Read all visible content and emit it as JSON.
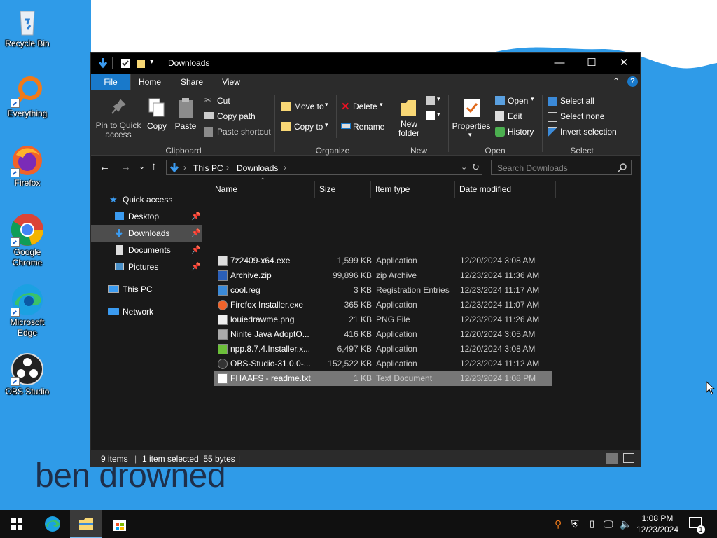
{
  "desktop": {
    "icons": [
      {
        "label": "Recycle Bin",
        "icon": "recycle-bin-icon"
      },
      {
        "label": "Everything",
        "icon": "everything-search-icon"
      },
      {
        "label": "Firefox",
        "icon": "firefox-icon"
      },
      {
        "label": "Google Chrome",
        "icon": "chrome-icon"
      },
      {
        "label": "Microsoft Edge",
        "icon": "edge-icon"
      },
      {
        "label": "OBS Studio",
        "icon": "obs-icon"
      }
    ],
    "wallpaper_text": "ben drowned",
    "colors": {
      "wallpaper_blue": "#2f9be8",
      "wallpaper_white": "#ffffff"
    }
  },
  "window": {
    "title": "Downloads",
    "controls": {
      "minimize": "—",
      "maximize": "☐",
      "close": "✕"
    },
    "tabs": [
      "File",
      "Home",
      "Share",
      "View"
    ],
    "active_tab": "Home",
    "ribbon": {
      "clipboard": {
        "pin": "Pin to Quick access",
        "copy": "Copy",
        "paste": "Paste",
        "cut": "Cut",
        "copy_path": "Copy path",
        "paste_shortcut": "Paste shortcut",
        "group": "Clipboard"
      },
      "organize": {
        "move_to": "Move to",
        "copy_to": "Copy to",
        "delete": "Delete",
        "rename": "Rename",
        "group": "Organize"
      },
      "new": {
        "new_folder": "New folder",
        "group": "New"
      },
      "open": {
        "properties": "Properties",
        "open": "Open",
        "edit": "Edit",
        "history": "History",
        "group": "Open"
      },
      "select": {
        "select_all": "Select all",
        "select_none": "Select none",
        "invert": "Invert selection",
        "group": "Select"
      }
    },
    "address": {
      "crumbs": [
        "This PC",
        "Downloads"
      ],
      "search_placeholder": "Search Downloads"
    },
    "nav": {
      "quick_access": "Quick access",
      "items": [
        "Desktop",
        "Downloads",
        "Documents",
        "Pictures"
      ],
      "this_pc": "This PC",
      "network": "Network",
      "selected": "Downloads"
    },
    "columns": [
      "Name",
      "Size",
      "Item type",
      "Date modified"
    ],
    "files": [
      {
        "name": "7z2409-x64.exe",
        "size": "1,599 KB",
        "type": "Application",
        "date": "12/20/2024 3:08 AM",
        "icon": "7zip-icon"
      },
      {
        "name": "Archive.zip",
        "size": "99,896 KB",
        "type": "zip Archive",
        "date": "12/23/2024 11:36 AM",
        "icon": "zip-icon"
      },
      {
        "name": "cool.reg",
        "size": "3 KB",
        "type": "Registration Entries",
        "date": "12/23/2024 11:17 AM",
        "icon": "registry-icon"
      },
      {
        "name": "Firefox Installer.exe",
        "size": "365 KB",
        "type": "Application",
        "date": "12/23/2024 11:07 AM",
        "icon": "firefox-icon"
      },
      {
        "name": "louiedrawme.png",
        "size": "21 KB",
        "type": "PNG File",
        "date": "12/23/2024 11:26 AM",
        "icon": "image-icon"
      },
      {
        "name": "Ninite Java AdoptO...",
        "size": "416 KB",
        "type": "Application",
        "date": "12/20/2024 3:05 AM",
        "icon": "ninite-icon"
      },
      {
        "name": "npp.8.7.4.Installer.x...",
        "size": "6,497 KB",
        "type": "Application",
        "date": "12/20/2024 3:08 AM",
        "icon": "notepadpp-icon"
      },
      {
        "name": "OBS-Studio-31.0.0-...",
        "size": "152,522 KB",
        "type": "Application",
        "date": "12/23/2024 11:12 AM",
        "icon": "obs-icon"
      },
      {
        "name": "FHAAFS - readme.txt",
        "size": "1 KB",
        "type": "Text Document",
        "date": "12/23/2024 1:08 PM",
        "icon": "text-file-icon"
      }
    ],
    "selected_file": "FHAAFS - readme.txt",
    "status": {
      "items": "9 items",
      "selected": "1 item selected  55 bytes"
    }
  },
  "taskbar": {
    "apps": [
      "start-icon",
      "edge-icon",
      "file-explorer-icon",
      "store-icon"
    ],
    "clock": {
      "time": "1:08 PM",
      "date": "12/23/2024"
    },
    "notification_count": "1"
  }
}
